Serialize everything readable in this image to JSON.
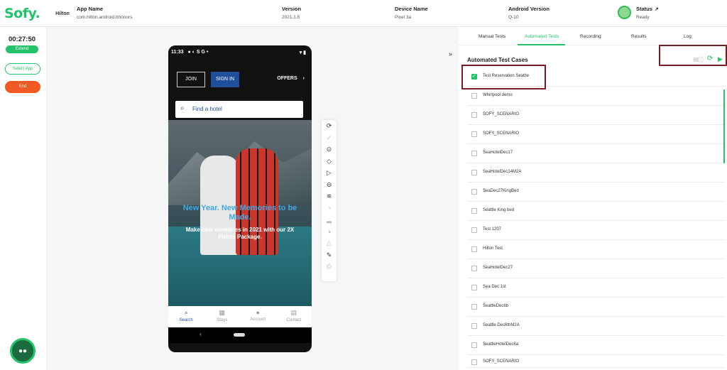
{
  "header": {
    "logo": "Sofy.",
    "app_thumb": "Hilton",
    "app_name_label": "App Name",
    "app_name_value": "com.hilton.android.hhonors",
    "version_label": "Version",
    "version_value": "2021.1.5",
    "device_label": "Device Name",
    "device_value": "Pixel 3a",
    "android_label": "Android Version",
    "android_value": "Q-10",
    "status_label": "Status",
    "status_value": "Ready",
    "status_color": "#2ebd59"
  },
  "leftrail": {
    "timer": "00:27:50",
    "extend": "Extend",
    "select_app": "Select App",
    "end": "End"
  },
  "phone": {
    "time": "11:33",
    "status_icons": "● ◐ S G •",
    "status_icons_right": "▾ ▮",
    "join": "JOIN",
    "sign_in": "SIGN IN",
    "offers": "OFFERS",
    "search_placeholder": "Find a hotel",
    "hero_title": "New Year. New Memories to be Made.",
    "hero_sub": "Make new memories in 2021 with our 2X Points Package.",
    "tabs": [
      {
        "label": "Search",
        "icon": "search-icon"
      },
      {
        "label": "Stays",
        "icon": "calendar-icon"
      },
      {
        "label": "Account",
        "icon": "person-icon"
      },
      {
        "label": "Contact",
        "icon": "chat-icon"
      }
    ]
  },
  "tools": [
    "rotate-icon",
    "check-circle-icon",
    "stop-circle-icon",
    "eraser-icon",
    "play-circle-icon",
    "minus-circle-icon",
    "wifi-icon",
    "alarm-icon",
    "signal-icon",
    "gauge-icon",
    "warning-icon",
    "edit-icon",
    "printer-icon"
  ],
  "panel": {
    "tabs": [
      "Manual Tests",
      "Automated Tests",
      "Recording",
      "Results",
      "Log"
    ],
    "title": "Automated Test Cases",
    "accent": "#22c36b",
    "tests": [
      {
        "name": "Test Reservation Seattle",
        "checked": true
      },
      {
        "name": "Whirlpool demo",
        "checked": false
      },
      {
        "name": "SOFY_SCENARIO",
        "checked": false
      },
      {
        "name": "SOFY_SCENARIO",
        "checked": false
      },
      {
        "name": "SeaHotelDec17",
        "checked": false
      },
      {
        "name": "SeaHotelDec14M2A",
        "checked": false
      },
      {
        "name": "SeaDec27KingBed",
        "checked": false
      },
      {
        "name": "Seattle King bed",
        "checked": false
      },
      {
        "name": "Test 1207",
        "checked": false
      },
      {
        "name": "Hilton Test",
        "checked": false
      },
      {
        "name": "SeaHotelDec27",
        "checked": false
      },
      {
        "name": "Sea Dec 1st",
        "checked": false
      },
      {
        "name": "SeattleDec6b",
        "checked": false
      },
      {
        "name": "Seattle Dec6thM2A",
        "checked": false
      },
      {
        "name": "SeattleHotelDec6a",
        "checked": false
      },
      {
        "name": "SOFY_SCENARIO",
        "checked": false
      }
    ]
  }
}
